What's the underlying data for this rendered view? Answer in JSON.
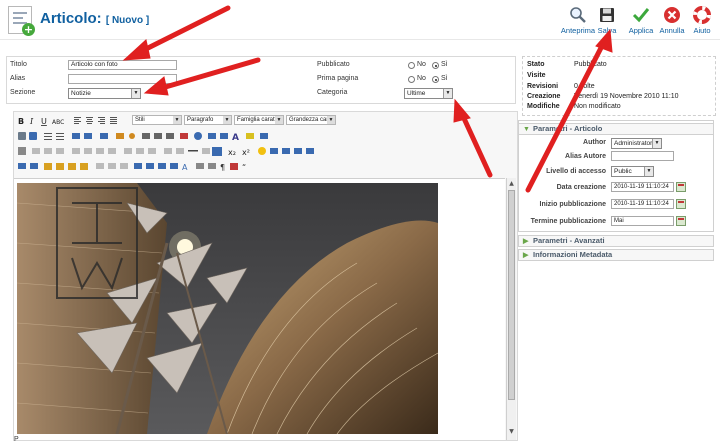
{
  "header": {
    "title": "Articolo:",
    "subtitle": "[ Nuovo ]",
    "icon": "article-add-icon"
  },
  "toolbar": [
    {
      "label": "Anteprima",
      "icon": "preview-magnifier-icon",
      "color": "#5a6a7a"
    },
    {
      "label": "Salva",
      "icon": "save-floppy-icon",
      "color": "#333333"
    },
    {
      "label": "Applica",
      "icon": "apply-check-icon",
      "color": "#3ca83c"
    },
    {
      "label": "Annulla",
      "icon": "cancel-icon",
      "color": "#d83030"
    },
    {
      "label": "Aiuto",
      "icon": "help-lifebuoy-icon",
      "color": "#d83030"
    }
  ],
  "details": {
    "title_label": "Titolo",
    "title_value": "Articolo con foto",
    "alias_label": "Alias",
    "alias_value": "",
    "section_label": "Sezione",
    "section_value": "Notizie",
    "published_label": "Pubblicato",
    "frontpage_label": "Prima pagina",
    "category_label": "Categoria",
    "category_value": "Ultime",
    "no_label": "No",
    "yes_label": "Sì",
    "published_selected": "Sì",
    "frontpage_selected": "Sì"
  },
  "editor": {
    "styles_dropdown": "Stili",
    "format_dropdown": "Paragrafo",
    "font_family_dropdown": "Famiglia caratt.",
    "font_size_dropdown": "Grandezza car.",
    "image_description": "night photo of modern building with metal sculpture",
    "path_label": "P"
  },
  "info": {
    "state_label": "Stato",
    "state_value": "Pubblicato",
    "hits_label": "Visite",
    "hits_value": "",
    "revisions_label": "Revisioni",
    "revisions_value": "0 volte",
    "created_label": "Creazione",
    "created_value": "Venerdì 19 Novembre 2010 11:10",
    "modified_label": "Modifiche",
    "modified_value": "Non modificato"
  },
  "params": {
    "section_title": "Parametri - Articolo",
    "author_label": "Author",
    "author_value": "Administrator",
    "alias_author_label": "Alias Autore",
    "alias_author_value": "",
    "access_label": "Livello di accesso",
    "access_value": "Public",
    "created_date_label": "Data creazione",
    "created_date_value": "2010-11-19 11:10:24",
    "publish_start_label": "Inizio pubblicazione",
    "publish_start_value": "2010-11-19 11:10:24",
    "publish_end_label": "Termine pubblicazione",
    "publish_end_value": "Mai"
  },
  "accordion": {
    "advanced": "Parametri - Avanzati",
    "metadata": "Informazioni Metadata"
  }
}
